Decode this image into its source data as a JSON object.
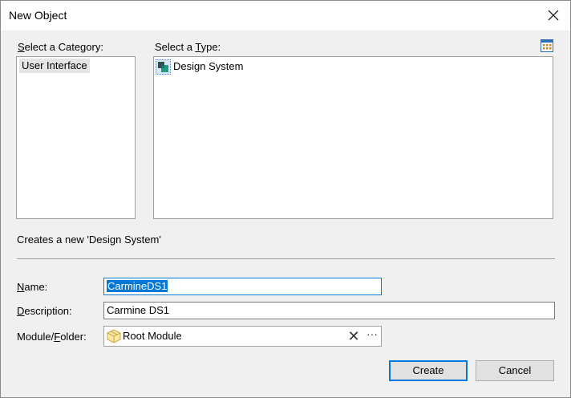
{
  "dialog": {
    "title": "New Object",
    "close_icon": "close-icon"
  },
  "category": {
    "label_accel": "S",
    "label_rest": "elect a Category:",
    "items": [
      "User Interface"
    ]
  },
  "type": {
    "label_prefix": "Select a ",
    "label_accel": "T",
    "label_rest": "ype:",
    "items": [
      {
        "label": "Design System",
        "icon": "design-system-icon"
      }
    ],
    "view_toggle_icon": "grid-view-icon"
  },
  "description_text": "Creates a new 'Design System'",
  "form": {
    "name_label_accel": "N",
    "name_label_rest": "ame:",
    "name_value": "CarmineDS1",
    "desc_label_accel": "D",
    "desc_label_rest": "escription:",
    "desc_value": "Carmine DS1",
    "module_label_prefix": "Module/",
    "module_label_accel": "F",
    "module_label_rest": "older:",
    "module_value": "Root Module",
    "module_icon": "module-box-icon",
    "clear_symbol": "✕",
    "more_symbol": "···"
  },
  "buttons": {
    "create": "Create",
    "cancel": "Cancel"
  },
  "colors": {
    "accent": "#0078d7",
    "background": "#f0f0f0",
    "selection": "#e5e5e5"
  }
}
